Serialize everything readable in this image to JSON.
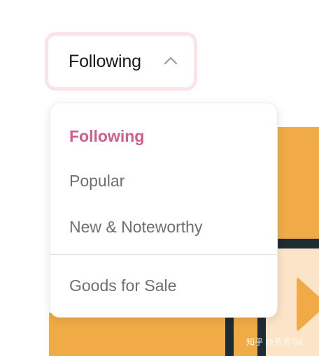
{
  "dropdown": {
    "selected": "Following",
    "items": [
      {
        "label": "Following",
        "active": true
      },
      {
        "label": "Popular",
        "active": false
      },
      {
        "label": "New & Noteworthy",
        "active": false
      },
      {
        "label": "Goods for Sale",
        "active": false
      }
    ]
  },
  "watermark": "知乎 @芳芳与li",
  "colors": {
    "active_item": "#cf5e88",
    "inactive_item": "#6e6e73",
    "trigger_ring": "#fbe3e8",
    "artwork_orange": "#f0ab46",
    "artwork_dark": "#1f2c33",
    "artwork_cream": "#fbe4c7"
  },
  "icons": {
    "trigger_chevron": "chevron-up-icon",
    "artwork_play": "play-icon"
  }
}
